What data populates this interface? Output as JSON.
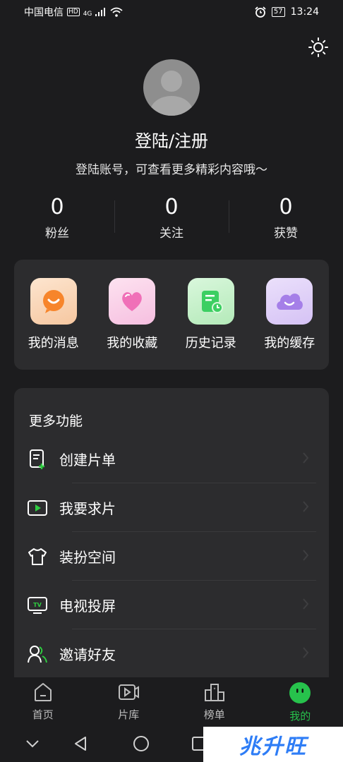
{
  "status_bar": {
    "carrier": "中国电信",
    "hd": "HD",
    "network": "4G",
    "battery": "57",
    "time": "13:24"
  },
  "profile": {
    "title": "登陆/注册",
    "subtitle": "登陆账号，可查看更多精彩内容哦～"
  },
  "stats": [
    {
      "value": "0",
      "label": "粉丝"
    },
    {
      "value": "0",
      "label": "关注"
    },
    {
      "value": "0",
      "label": "获赞"
    }
  ],
  "quick_actions": [
    {
      "label": "我的消息",
      "icon": "message-icon"
    },
    {
      "label": "我的收藏",
      "icon": "heart-icon"
    },
    {
      "label": "历史记录",
      "icon": "history-icon"
    },
    {
      "label": "我的缓存",
      "icon": "cloud-icon"
    }
  ],
  "more": {
    "title": "更多功能",
    "items": [
      {
        "label": "创建片单",
        "icon": "create-list-icon"
      },
      {
        "label": "我要求片",
        "icon": "request-video-icon"
      },
      {
        "label": "装扮空间",
        "icon": "tshirt-icon"
      },
      {
        "label": "电视投屏",
        "icon": "tv-cast-icon"
      },
      {
        "label": "邀请好友",
        "icon": "invite-friends-icon"
      }
    ]
  },
  "tabs": [
    {
      "label": "首页",
      "icon": "home-icon"
    },
    {
      "label": "片库",
      "icon": "library-icon"
    },
    {
      "label": "榜单",
      "icon": "ranking-icon"
    },
    {
      "label": "我的",
      "icon": "me-icon",
      "active": true
    }
  ],
  "tv_icon_text": "TV",
  "watermark": "兆升旺",
  "colors": {
    "background": "#1c1c1e",
    "card": "#2c2c2e",
    "accent": "#27c24c",
    "tv_green": "#2ecc40"
  }
}
